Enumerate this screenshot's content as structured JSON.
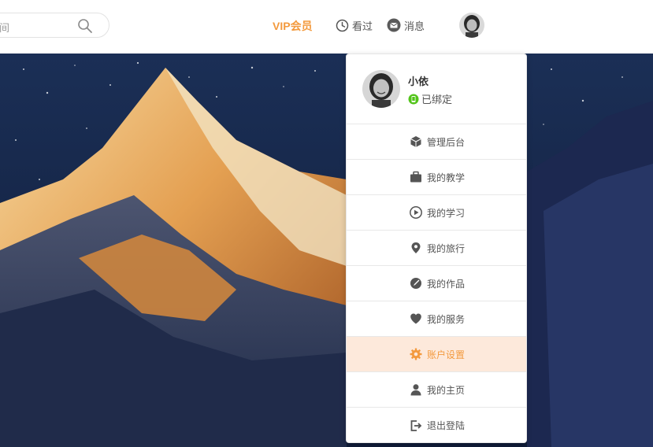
{
  "header": {
    "search": {
      "placeholder": "间"
    },
    "vip_label": "VIP会员",
    "history_label": "看过",
    "message_label": "消息"
  },
  "dropdown": {
    "profile": {
      "name": "小依",
      "bind_status": "已绑定"
    },
    "menu": [
      {
        "label": "管理后台",
        "icon": "cube-icon"
      },
      {
        "label": "我的教学",
        "icon": "briefcase-icon"
      },
      {
        "label": "我的学习",
        "icon": "play-circle-icon"
      },
      {
        "label": "我的旅行",
        "icon": "map-pin-icon"
      },
      {
        "label": "我的作品",
        "icon": "palette-icon"
      },
      {
        "label": "我的服务",
        "icon": "heart-icon"
      },
      {
        "label": "账户设置",
        "icon": "gear-icon",
        "active": true
      },
      {
        "label": "我的主页",
        "icon": "user-icon"
      },
      {
        "label": "退出登陆",
        "icon": "logout-icon"
      }
    ]
  },
  "colors": {
    "accent": "#f39a3e",
    "active_bg": "#fde9db",
    "icon": "#555555"
  }
}
